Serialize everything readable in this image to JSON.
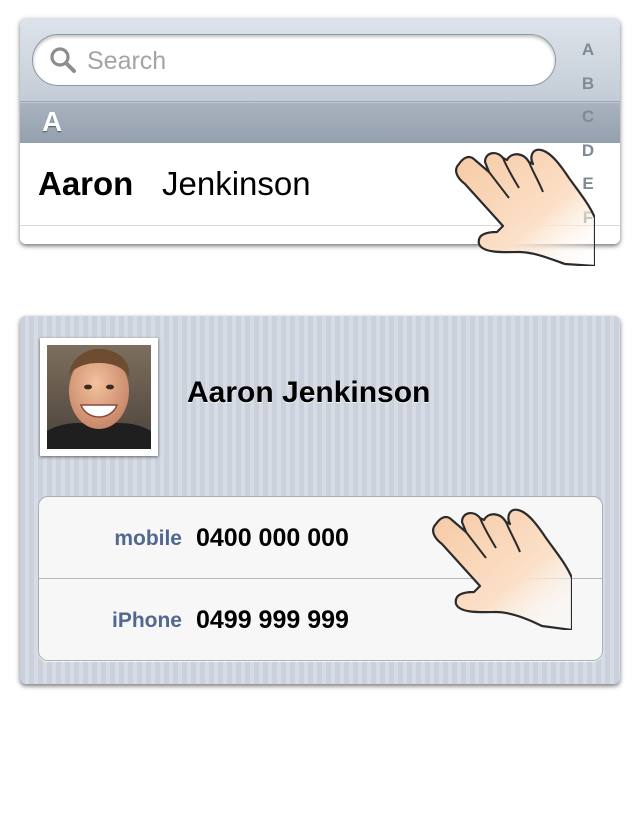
{
  "contacts_list": {
    "search": {
      "placeholder": "Search",
      "icon": "search-icon"
    },
    "section_header": "A",
    "contact": {
      "first_name": "Aaron",
      "last_name": "Jenkinson"
    },
    "index_letters": [
      "A",
      "B",
      "C",
      "D",
      "E",
      "F"
    ]
  },
  "contact_detail": {
    "name": "Aaron Jenkinson",
    "photo_icon": "contact-photo",
    "phones": [
      {
        "label": "mobile",
        "number": "0400 000 000"
      },
      {
        "label": "iPhone",
        "number": "0499 999 999"
      }
    ]
  },
  "gesture_icon": "tap-hand-icon",
  "colors": {
    "label_blue": "#51688f",
    "section_header": "#9ea9b6",
    "hand_skin": "#f9d7b8"
  }
}
